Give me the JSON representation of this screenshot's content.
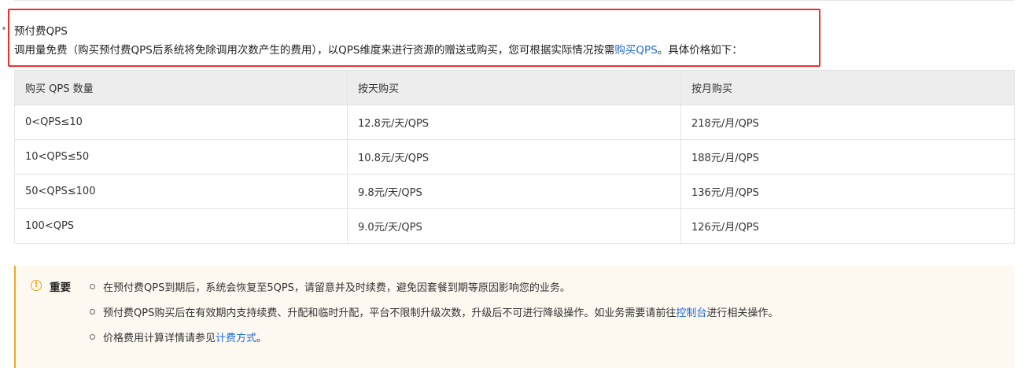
{
  "item": {
    "title": "预付费QPS",
    "desc_before": "调用量免费（购买预付费QPS后系统将免除调用次数产生的费用），以QPS维度来进行资源的赠送或购买，您可根据实际情况按需",
    "desc_link": "购买QPS",
    "desc_after": "。具体价格如下："
  },
  "table": {
    "headers": [
      "购买 QPS 数量",
      "按天购买",
      "按月购买"
    ],
    "rows": [
      [
        "0<QPS≤10",
        "12.8元/天/QPS",
        "218元/月/QPS"
      ],
      [
        "10<QPS≤50",
        "10.8元/天/QPS",
        "188元/月/QPS"
      ],
      [
        "50<QPS≤100",
        "9.8元/天/QPS",
        "136元/月/QPS"
      ],
      [
        "100<QPS",
        "9.0元/天/QPS",
        "126元/月/QPS"
      ]
    ]
  },
  "notice": {
    "icon": "warning-circle-icon",
    "icon_glyph": "!",
    "label": "重要",
    "items": [
      {
        "before": "在预付费QPS到期后，系统会恢复至5QPS，请留意并及时续费，避免因套餐到期等原因影响您的业务。",
        "link": "",
        "after": ""
      },
      {
        "before": "预付费QPS购买后在有效期内支持续费、升配和临时升配，平台不限制升级次数，升级后不可进行降级操作。如业务需要请前往",
        "link": "控制台",
        "after": "进行相关操作。"
      },
      {
        "before": "价格费用计算详情请参见",
        "link": "计费方式",
        "after": "。"
      }
    ]
  },
  "colors": {
    "highlight_border": "#ea2f2f",
    "link": "#1f6bd6",
    "notice_accent": "#f6a623",
    "notice_bg": "#fdf8f0",
    "table_header_bg": "#ededed"
  }
}
